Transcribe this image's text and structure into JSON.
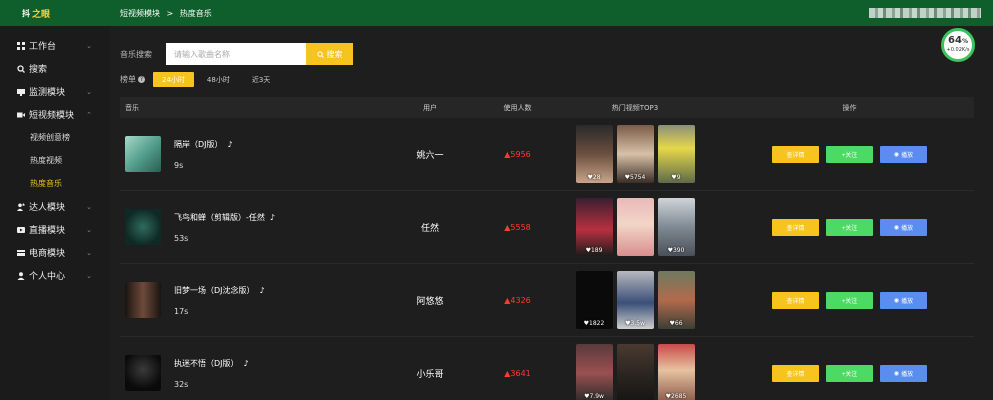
{
  "logo": {
    "text1": "抖",
    "text2": "之眼"
  },
  "header": {
    "breadcrumb": [
      "短视频模块",
      ">",
      "热度音乐"
    ]
  },
  "sidebar": {
    "items": [
      {
        "label": "工作台",
        "icon": "grid-icon",
        "chev": "⌄"
      },
      {
        "label": "搜索",
        "icon": "search-icon",
        "chev": ""
      },
      {
        "label": "监测模块",
        "icon": "monitor-icon",
        "chev": "⌄"
      },
      {
        "label": "短视频模块",
        "icon": "video-icon",
        "chev": "⌃"
      }
    ],
    "sub": [
      {
        "label": "视频创意榜",
        "active": false
      },
      {
        "label": "热度视频",
        "active": false
      },
      {
        "label": "热度音乐",
        "active": true
      }
    ],
    "items2": [
      {
        "label": "达人模块",
        "icon": "star-user-icon",
        "chev": "⌄"
      },
      {
        "label": "直播模块",
        "icon": "live-icon",
        "chev": "⌄"
      },
      {
        "label": "电商模块",
        "icon": "shop-icon",
        "chev": "⌄"
      },
      {
        "label": "个人中心",
        "icon": "person-icon",
        "chev": "⌄"
      }
    ]
  },
  "search": {
    "label": "音乐搜索",
    "placeholder": "请输入歌曲名称",
    "button": "搜索"
  },
  "tabs": {
    "label": "榜单",
    "items": [
      "24小时",
      "48小时",
      "近3天"
    ],
    "active": 0
  },
  "progress": {
    "value": "64",
    "unit": "%",
    "speed": "+0.02K/s"
  },
  "table": {
    "headers": {
      "music": "音乐",
      "user": "用户",
      "count": "使用人数",
      "top3": "热门视频TOP3",
      "ops": "操作"
    },
    "buttons": {
      "detail": "查详情",
      "follow": "+关注",
      "play": "播放"
    },
    "rows": [
      {
        "title": "隔岸（DJ版）",
        "duration": "9s",
        "user": "姚六一",
        "count": "5956",
        "likes": [
          "28",
          "5754",
          "9"
        ]
      },
      {
        "title": "飞鸟和蝉（剪辑版）-任然",
        "duration": "53s",
        "user": "任然",
        "count": "5558",
        "likes": [
          "189",
          "",
          "390"
        ]
      },
      {
        "title": "旧梦一场（DJ沈念版）",
        "duration": "17s",
        "user": "阿悠悠",
        "count": "4326",
        "likes": [
          "1822",
          "3.5w",
          "66"
        ]
      },
      {
        "title": "执迷不悟（DJ版）",
        "duration": "32s",
        "user": "小乐哥",
        "count": "3641",
        "likes": [
          "7.9w",
          "",
          "2685"
        ]
      }
    ]
  },
  "colors": {
    "header": "#0e5f2c",
    "accent": "#f7c31f",
    "follow": "#4cd964",
    "play": "#5b8cf0",
    "up": "#ff3b30"
  }
}
